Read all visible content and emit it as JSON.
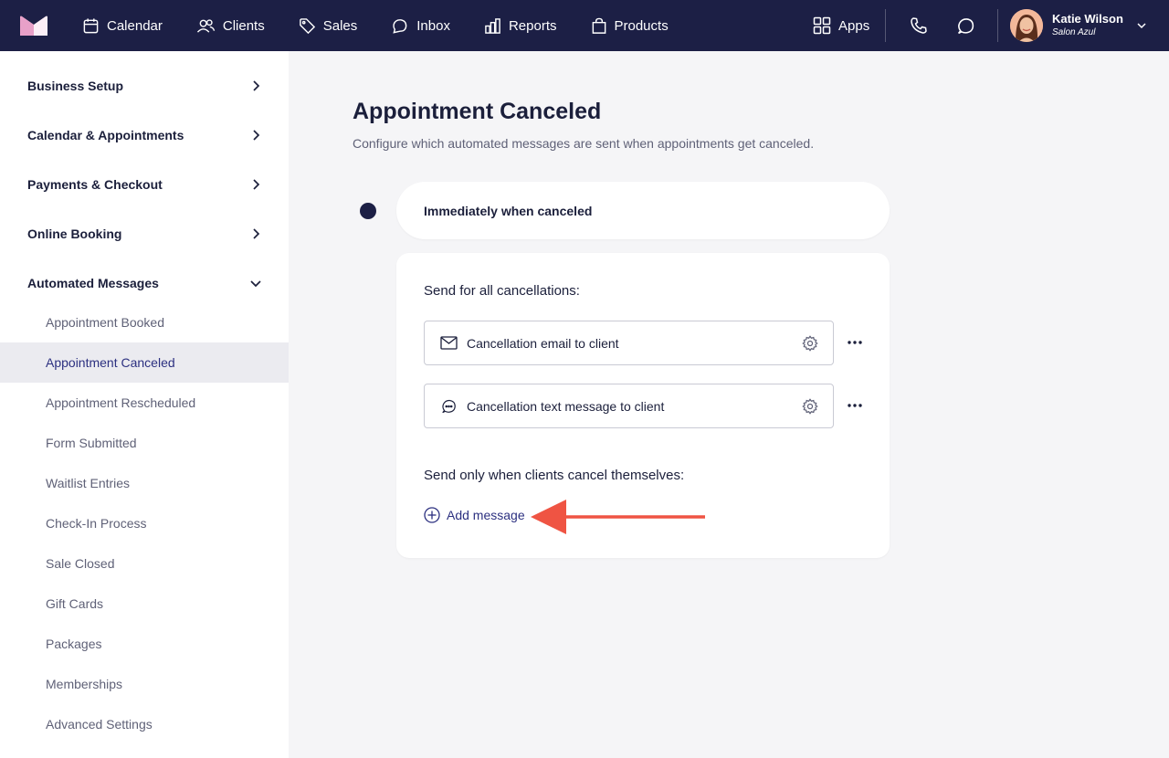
{
  "topbar": {
    "nav": [
      {
        "label": "Calendar",
        "icon": "calendar-icon"
      },
      {
        "label": "Clients",
        "icon": "clients-icon"
      },
      {
        "label": "Sales",
        "icon": "tag-icon"
      },
      {
        "label": "Inbox",
        "icon": "inbox-icon"
      },
      {
        "label": "Reports",
        "icon": "reports-icon"
      },
      {
        "label": "Products",
        "icon": "shopping-bag-icon"
      }
    ],
    "apps_label": "Apps",
    "user": {
      "name": "Katie Wilson",
      "business": "Salon Azul"
    },
    "colors": {
      "background": "#1c1f45",
      "logo_pink": "#e8a0c8",
      "logo_light": "#f3d9ec"
    }
  },
  "sidebar": {
    "sections": [
      {
        "label": "Business Setup",
        "expanded": false
      },
      {
        "label": "Calendar & Appointments",
        "expanded": false
      },
      {
        "label": "Payments & Checkout",
        "expanded": false
      },
      {
        "label": "Online Booking",
        "expanded": false
      },
      {
        "label": "Automated Messages",
        "expanded": true
      }
    ],
    "items": [
      {
        "label": "Appointment Booked",
        "active": false
      },
      {
        "label": "Appointment Canceled",
        "active": true
      },
      {
        "label": "Appointment Rescheduled",
        "active": false
      },
      {
        "label": "Form Submitted",
        "active": false
      },
      {
        "label": "Waitlist Entries",
        "active": false
      },
      {
        "label": "Check-In Process",
        "active": false
      },
      {
        "label": "Sale Closed",
        "active": false
      },
      {
        "label": "Gift Cards",
        "active": false
      },
      {
        "label": "Packages",
        "active": false
      },
      {
        "label": "Memberships",
        "active": false
      },
      {
        "label": "Advanced Settings",
        "active": false
      }
    ]
  },
  "main": {
    "title": "Appointment Canceled",
    "subtitle": "Configure which automated messages are sent when appointments get canceled.",
    "trigger_label": "Immediately when canceled",
    "all_heading": "Send for all cancellations:",
    "messages": [
      {
        "label": "Cancellation email to client",
        "icon": "mail-icon"
      },
      {
        "label": "Cancellation text message to client",
        "icon": "chat-bubble-icon"
      }
    ],
    "self_heading": "Send only when clients cancel themselves:",
    "add_label": "Add message",
    "annotation_color": "#ef5443"
  }
}
